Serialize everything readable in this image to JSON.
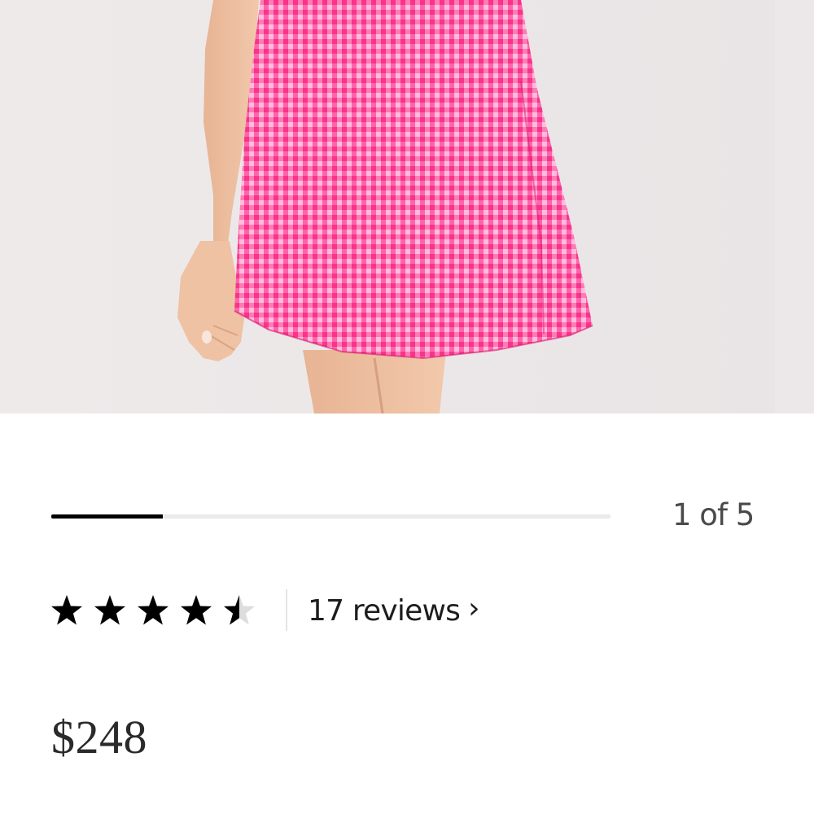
{
  "product": {
    "image_alt": "Pink gingham mini skirt",
    "colors": {
      "pink": "#ff4a9f",
      "background": "#ede9ea"
    }
  },
  "carousel": {
    "counter": "1 of 5",
    "current": 1,
    "total": 5
  },
  "rating": {
    "value": 4.5,
    "max": 5,
    "reviews_label": "17 reviews",
    "chevron": "›"
  },
  "price": "$248"
}
